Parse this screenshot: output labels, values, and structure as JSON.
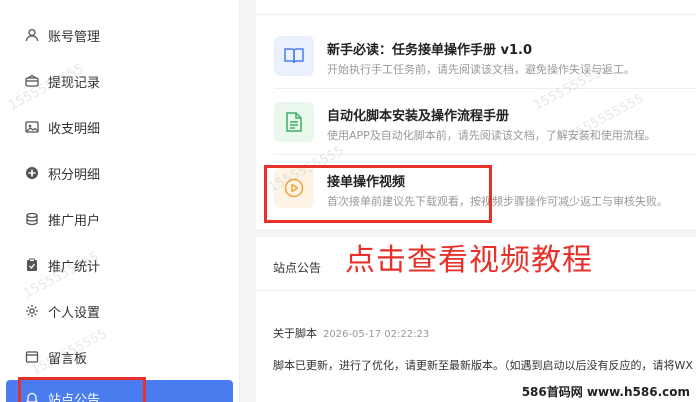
{
  "sidebar": {
    "items": [
      {
        "label": "账号管理",
        "icon": "user-icon"
      },
      {
        "label": "提现记录",
        "icon": "wallet-icon"
      },
      {
        "label": "收支明细",
        "icon": "image-icon"
      },
      {
        "label": "积分明细",
        "icon": "points-icon"
      },
      {
        "label": "推广用户",
        "icon": "database-icon"
      },
      {
        "label": "推广统计",
        "icon": "clipboard-icon"
      },
      {
        "label": "个人设置",
        "icon": "gear-icon"
      },
      {
        "label": "留言板",
        "icon": "message-icon"
      },
      {
        "label": "站点公告",
        "icon": "bell-icon",
        "active": true
      }
    ]
  },
  "guides": [
    {
      "title": "新手必读：任务接单操作手册 v1.0",
      "desc": "开始执行手工任务前，请先阅读该文档，避免操作失误与返工。",
      "icon": "book-icon"
    },
    {
      "title": "自动化脚本安装及操作流程手册",
      "desc": "使用APP及自动化脚本前，请先阅读该文档，了解安装和使用流程。",
      "icon": "document-icon"
    },
    {
      "title": "接单操作视频",
      "desc": "首次接单前建议先下载观看，按视频步骤操作可减少返工与审核失败。",
      "icon": "play-icon"
    }
  ],
  "notice": {
    "header": "站点公告",
    "title": "关于脚本",
    "date": "2026-05-17 02:22:23",
    "body": "脚本已更新，进行了优化，请更新至最新版本。（如遇到启动以后没有反应的，请将WX"
  },
  "annotation": {
    "text": "点击查看视频教程"
  },
  "watermark": {
    "text": "1555555555",
    "corner": "586首码网 www.h586.com"
  },
  "colors": {
    "active": "#4a7cf0",
    "annotation": "#e8302b",
    "book_bg": "#eaf1fd",
    "doc_bg": "#eaf7ec",
    "play_bg": "#fdf4e6"
  }
}
